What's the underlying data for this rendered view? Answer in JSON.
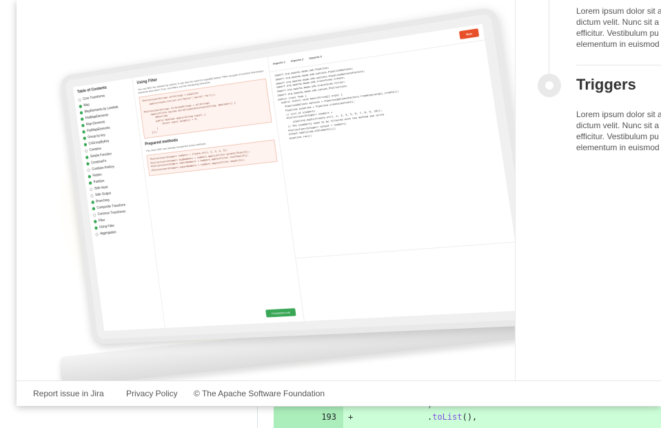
{
  "background": {
    "diff": {
      "line_number": "193",
      "sign": "+",
      "code_prefix": ".",
      "code_method": "toList",
      "code_suffix": "(),",
      "prev_code": ","
    }
  },
  "hero": {
    "screen": {
      "toc": {
        "title": "Table of Contents",
        "items": [
          {
            "label": "Core Transforms",
            "done": false
          },
          {
            "label": "Map",
            "done": true
          },
          {
            "label": "MapElements by Lambda",
            "done": true
          },
          {
            "label": "FlatMapElements",
            "done": true
          },
          {
            "label": "Map Elements",
            "done": true
          },
          {
            "label": "FlatMapElements",
            "done": true
          },
          {
            "label": "Group by key",
            "done": true
          },
          {
            "label": "CoGroupByKey",
            "done": true
          },
          {
            "label": "Combine",
            "done": false
          },
          {
            "label": "Simple Function",
            "done": true
          },
          {
            "label": "CombineFn",
            "done": true
          },
          {
            "label": "Combine PerKey",
            "done": false
          },
          {
            "label": "Flatten",
            "done": true
          },
          {
            "label": "Partition",
            "done": true
          },
          {
            "label": "Side Input",
            "done": false
          },
          {
            "label": "Side Output",
            "done": false
          },
          {
            "label": "Branching",
            "done": true
          },
          {
            "label": "Composite Transform",
            "done": true
          },
          {
            "label": "Common Transforms",
            "done": false
          },
          {
            "label": "Filter",
            "done": true
          },
          {
            "label": "Using Filter",
            "done": true
          },
          {
            "label": "Aggregation",
            "done": false
          }
        ]
      },
      "doc": {
        "title": "Using Filter",
        "intro": "You can filter the dataset by criteria. It can also be used for equality based. Filter accepts a function that keeps elements that return True, and filters out the remaining elements.",
        "code1": "PCollection<String> allStrings = pipeline\n    .apply(Create.of(List.of(\"Hello\",\"world\",\"Hi\")));\n\nPCollection<String> filteredStrings = allStrings\n    .apply(Filter.by(new SerializableFunction<String, Boolean>() {\n        @Override\n        public Boolean apply(String input) {\n            return input.length() > 3;\n        }\n    }));",
        "subtitle": "Prepared methods",
        "intro2": "The Java SDK has already completed some methods",
        "code2": "PCollection<Integer> numbers = Create.of(1, 2, 3, 4, 5);\nPCollection<Integer> bigNumbers = numbers.apply(Filter.greaterThan(3));\nPCollection<Integer> smallNumbers = numbers.apply(Filter.lessThan(3));\nPCollection<Integer> equalNumbers = numbers.apply(Filter.equal(3));",
        "button": "Completed unit"
      },
      "editor": {
        "tabs": [
          "Imports 1",
          "Imports 2",
          "Imports 3"
        ],
        "run_label": "Run",
        "code_lines": [
          "import org.apache.beam.sdk.Pipeline;",
          "import org.apache.beam.sdk.options.PipelineOptions;",
          "import org.apache.beam.sdk.options.PipelineOptionsFactory;",
          "import org.apache.beam.sdk.transforms.Create;",
          "import org.apache.beam.sdk.transforms.Filter;",
          "import org.apache.beam.sdk.values.PCollection;",
          "",
          "public class Task {",
          "  public static void main(String[] args) {",
          "    PipelineOptions options = PipelineOptionsFactory.fromArgs(args).create();",
          "    Pipeline pipeline = Pipeline.create(options);",
          "",
          "    // List of elements",
          "    PCollection<Integer> numbers =",
          "        pipeline.apply(Create.of(1, 2, 3, 4, 5, 6, 7, 8, 9, 10));",
          "",
          "    // The [numbers] need to be filtered with the method you write",
          "    PCollection<Integer> output = numbers;",
          "",
          "    output.apply(Log.ofElements());",
          "",
          "    pipeline.run();"
        ]
      }
    }
  },
  "timeline": {
    "top_text_lines": [
      "Lorem ipsum dolor sit a",
      "dictum velit. Nunc sit a",
      "efficitur. Vestibulum pu",
      "elementum in euismod"
    ],
    "heading": "Triggers",
    "bottom_text_lines": [
      "Lorem ipsum dolor sit a",
      "dictum velit. Nunc sit a",
      "efficitur. Vestibulum pu",
      "elementum in euismod"
    ]
  },
  "footer": {
    "report_issue": "Report issue in Jira",
    "privacy_policy": "Privacy Policy",
    "copyright": "© The Apache Software Foundation"
  }
}
